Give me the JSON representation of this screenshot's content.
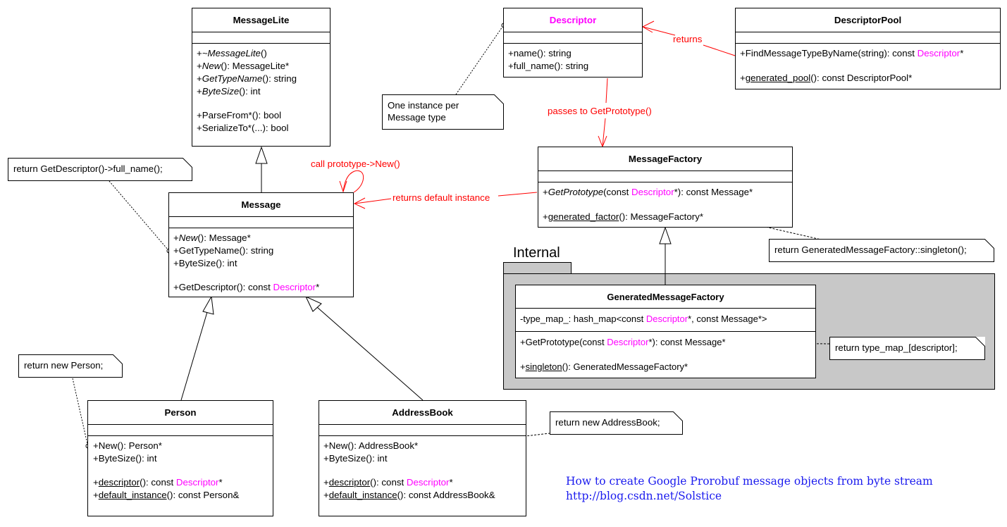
{
  "diagram_title": "How to create Google Prorobuf message objects from byte stream",
  "caption": {
    "line1": "How to create Google Prorobuf message objects from byte stream",
    "line2": "http://blog.csdn.net/Solstice"
  },
  "colors": {
    "descriptor_highlight": "#ff00ff",
    "annotation_red": "#ff0000",
    "caption_blue": "#1a1aee",
    "package_fill": "#c8c8c8"
  },
  "package": {
    "name": "Internal"
  },
  "classes": {
    "message_lite": {
      "name": "MessageLite",
      "ops": [
        {
          "prefix": "+",
          "italic": "~MessageLite",
          "rest": "()"
        },
        {
          "prefix": "+",
          "italic": "New",
          "rest": "(): MessageLite*"
        },
        {
          "prefix": "+",
          "italic": "GetTypeName",
          "rest": "(): string"
        },
        {
          "prefix": "+",
          "italic": "ByteSize",
          "rest": "(): int"
        },
        {
          "text": "+ParseFrom*(): bool"
        },
        {
          "text": "+SerializeTo*(...): bool"
        }
      ]
    },
    "message": {
      "name": "Message",
      "ops": [
        {
          "prefix": "+",
          "italic": "New",
          "rest": "(): Message*"
        },
        {
          "text": "+GetTypeName(): string"
        },
        {
          "text": "+ByteSize(): int"
        },
        {
          "before": "+GetDescriptor(): const ",
          "mag": "Descriptor",
          "after": "*"
        }
      ]
    },
    "descriptor": {
      "name": "Descriptor",
      "ops": [
        {
          "text": "+name(): string"
        },
        {
          "text": "+full_name(): string"
        }
      ]
    },
    "descriptor_pool": {
      "name": "DescriptorPool",
      "ops": [
        {
          "before": "+FindMessageTypeByName(string): const ",
          "mag": "Descriptor",
          "after": "*"
        },
        {
          "prefix": "+",
          "underline": "generated_pool",
          "rest": "(): const DescriptorPool*"
        }
      ]
    },
    "message_factory": {
      "name": "MessageFactory",
      "ops": [
        {
          "prefix": "+",
          "italic": "GetPrototype",
          "mid": "(const ",
          "mag": "Descriptor",
          "after": "*): const Message*"
        },
        {
          "prefix": "+",
          "underline": "generated_factor",
          "rest": "(): MessageFactory*"
        }
      ]
    },
    "generated_message_factory": {
      "name": "GeneratedMessageFactory",
      "attr": {
        "before": "-type_map_: hash_map<const ",
        "mag": "Descriptor",
        "after": "*, const Message*>"
      },
      "ops": [
        {
          "before": "+GetPrototype(const ",
          "mag": "Descriptor",
          "after": "*): const Message*"
        },
        {
          "prefix": "+",
          "underline": "singleton",
          "rest": "(): GeneratedMessageFactory*"
        }
      ]
    },
    "person": {
      "name": "Person",
      "ops": [
        {
          "text": "+New(): Person*"
        },
        {
          "text": "+ByteSize(): int"
        },
        {
          "prefix": "+",
          "underline": "descriptor",
          "mid": "(): const ",
          "mag": "Descriptor",
          "after": "*"
        },
        {
          "prefix": "+",
          "underline": "default_instance",
          "rest": "(): const Person&"
        }
      ]
    },
    "address_book": {
      "name": "AddressBook",
      "ops": [
        {
          "text": "+New(): AddressBook*"
        },
        {
          "text": "+ByteSize(): int"
        },
        {
          "prefix": "+",
          "underline": "descriptor",
          "mid": "(): const ",
          "mag": "Descriptor",
          "after": "*"
        },
        {
          "prefix": "+",
          "underline": "default_instance",
          "rest": "(): const AddressBook&"
        }
      ]
    }
  },
  "notes": {
    "full_name": "return GetDescriptor()->full_name();",
    "one_instance_line1": "One instance per",
    "one_instance_line2": "Message type",
    "new_person": "return new Person;",
    "new_address_book": "return new AddressBook;",
    "singleton": "return GeneratedMessageFactory::singleton();",
    "type_map": "return type_map_[descriptor];"
  },
  "annotations": {
    "returns": "returns",
    "passes_to": "passes to GetPrototype()",
    "call_prototype": "call prototype->New()",
    "returns_default": "returns default instance"
  }
}
